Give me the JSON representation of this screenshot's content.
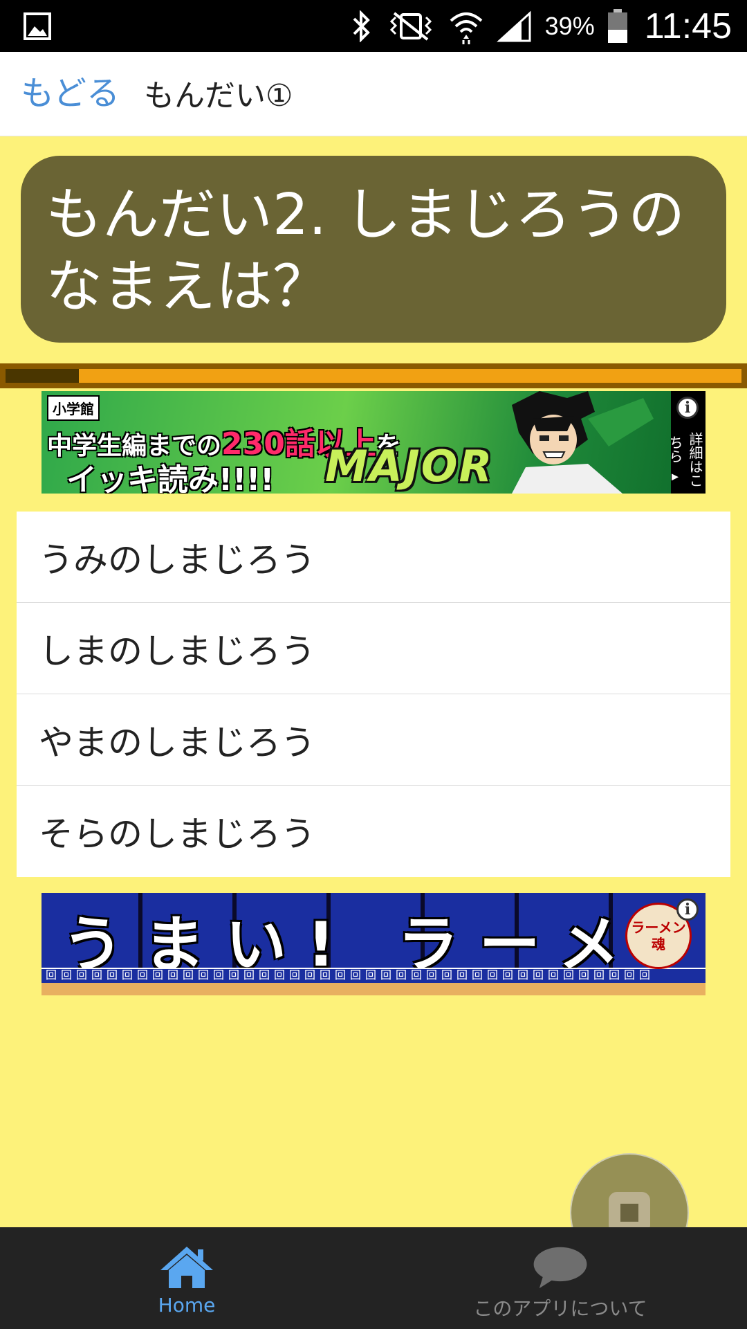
{
  "status_bar": {
    "battery_percent": "39%",
    "time": "11:45",
    "icons": [
      "gallery-icon",
      "bluetooth-icon",
      "vibrate-icon",
      "wifi-icon",
      "signal-icon",
      "battery-icon"
    ]
  },
  "header": {
    "back_label": "もどる",
    "title": "もんだい①"
  },
  "question": {
    "text": "もんだい2. しまじろうの なまえは？"
  },
  "progress": {
    "value": 0.1
  },
  "ads": {
    "top": {
      "publisher": "小学館",
      "headline_prefix": "中学生編までの",
      "headline_highlight": "230話以上",
      "headline_suffix": "を",
      "headline_line2": "イッキ読み!!!!",
      "logo": "MAJOR",
      "side_text": "詳細はこちら ▸",
      "info_symbol": "i"
    },
    "bottom": {
      "text": "うまい! ラーメン",
      "logo": "ラーメン魂",
      "info_symbol": "i"
    }
  },
  "options": [
    "うみのしまじろう",
    "しまのしまじろう",
    "やまのしまじろう",
    "そらのしまじろう"
  ],
  "tabs": {
    "home_label": "Home",
    "about_label": "このアプリについて"
  },
  "colors": {
    "background": "#fdf27a",
    "question_bg": "#6a6434",
    "link": "#4a8ed6",
    "tab_active": "#5aa7f0",
    "tab_bar": "#232323"
  }
}
